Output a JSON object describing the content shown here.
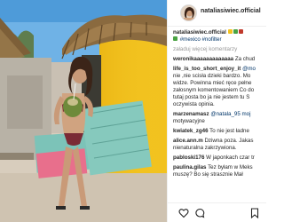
{
  "post": {
    "username": "nataliasiwiec.official",
    "caption_tags": "#mexico #nofilter",
    "load_more": "załaduj więcej komentarzy"
  },
  "comments": [
    {
      "user": "weronikaaaaaaaaaaaaa",
      "text": "Za chud"
    },
    {
      "user": "life_is_too_short_enjoy_it",
      "text": "@mo"
    },
    {
      "user": "",
      "text": "nie ,nie scisła dzieki bardzo. Mo"
    },
    {
      "user": "",
      "text": "widze. Powinna mieć ręce pełne"
    },
    {
      "user": "",
      "text": "załosnym komentowaniem Co do"
    },
    {
      "user": "",
      "text": "tutaj posta bo ja nie jestem tu S"
    },
    {
      "user": "",
      "text": "oczywista opinia."
    },
    {
      "user": "marzenamasz",
      "text": "@natala_95 moj"
    },
    {
      "user": "",
      "text": "motywacyjne"
    },
    {
      "user": "kwiatek_zg46",
      "text": "To nie jest ładne"
    },
    {
      "user": "alice.ann.m",
      "text": "Dziwna poza. Jakas"
    },
    {
      "user": "",
      "text": "nienaturalna zakrzywiona."
    },
    {
      "user": "pabloski176",
      "text": "W japonkach czar tr"
    },
    {
      "user": "paulina.gilas",
      "text": "Tez byłam w Meks"
    },
    {
      "user": "",
      "text": "muszę? Bo się strasznie Mał"
    }
  ],
  "icons": [
    "heart-icon",
    "comment-icon",
    "bookmark-icon"
  ],
  "colors": {
    "sky": "#5ea7e0",
    "yellow_wall": "#f2c21e",
    "thatch": "#8a6a3f",
    "link": "#003569",
    "muted": "#999999"
  }
}
